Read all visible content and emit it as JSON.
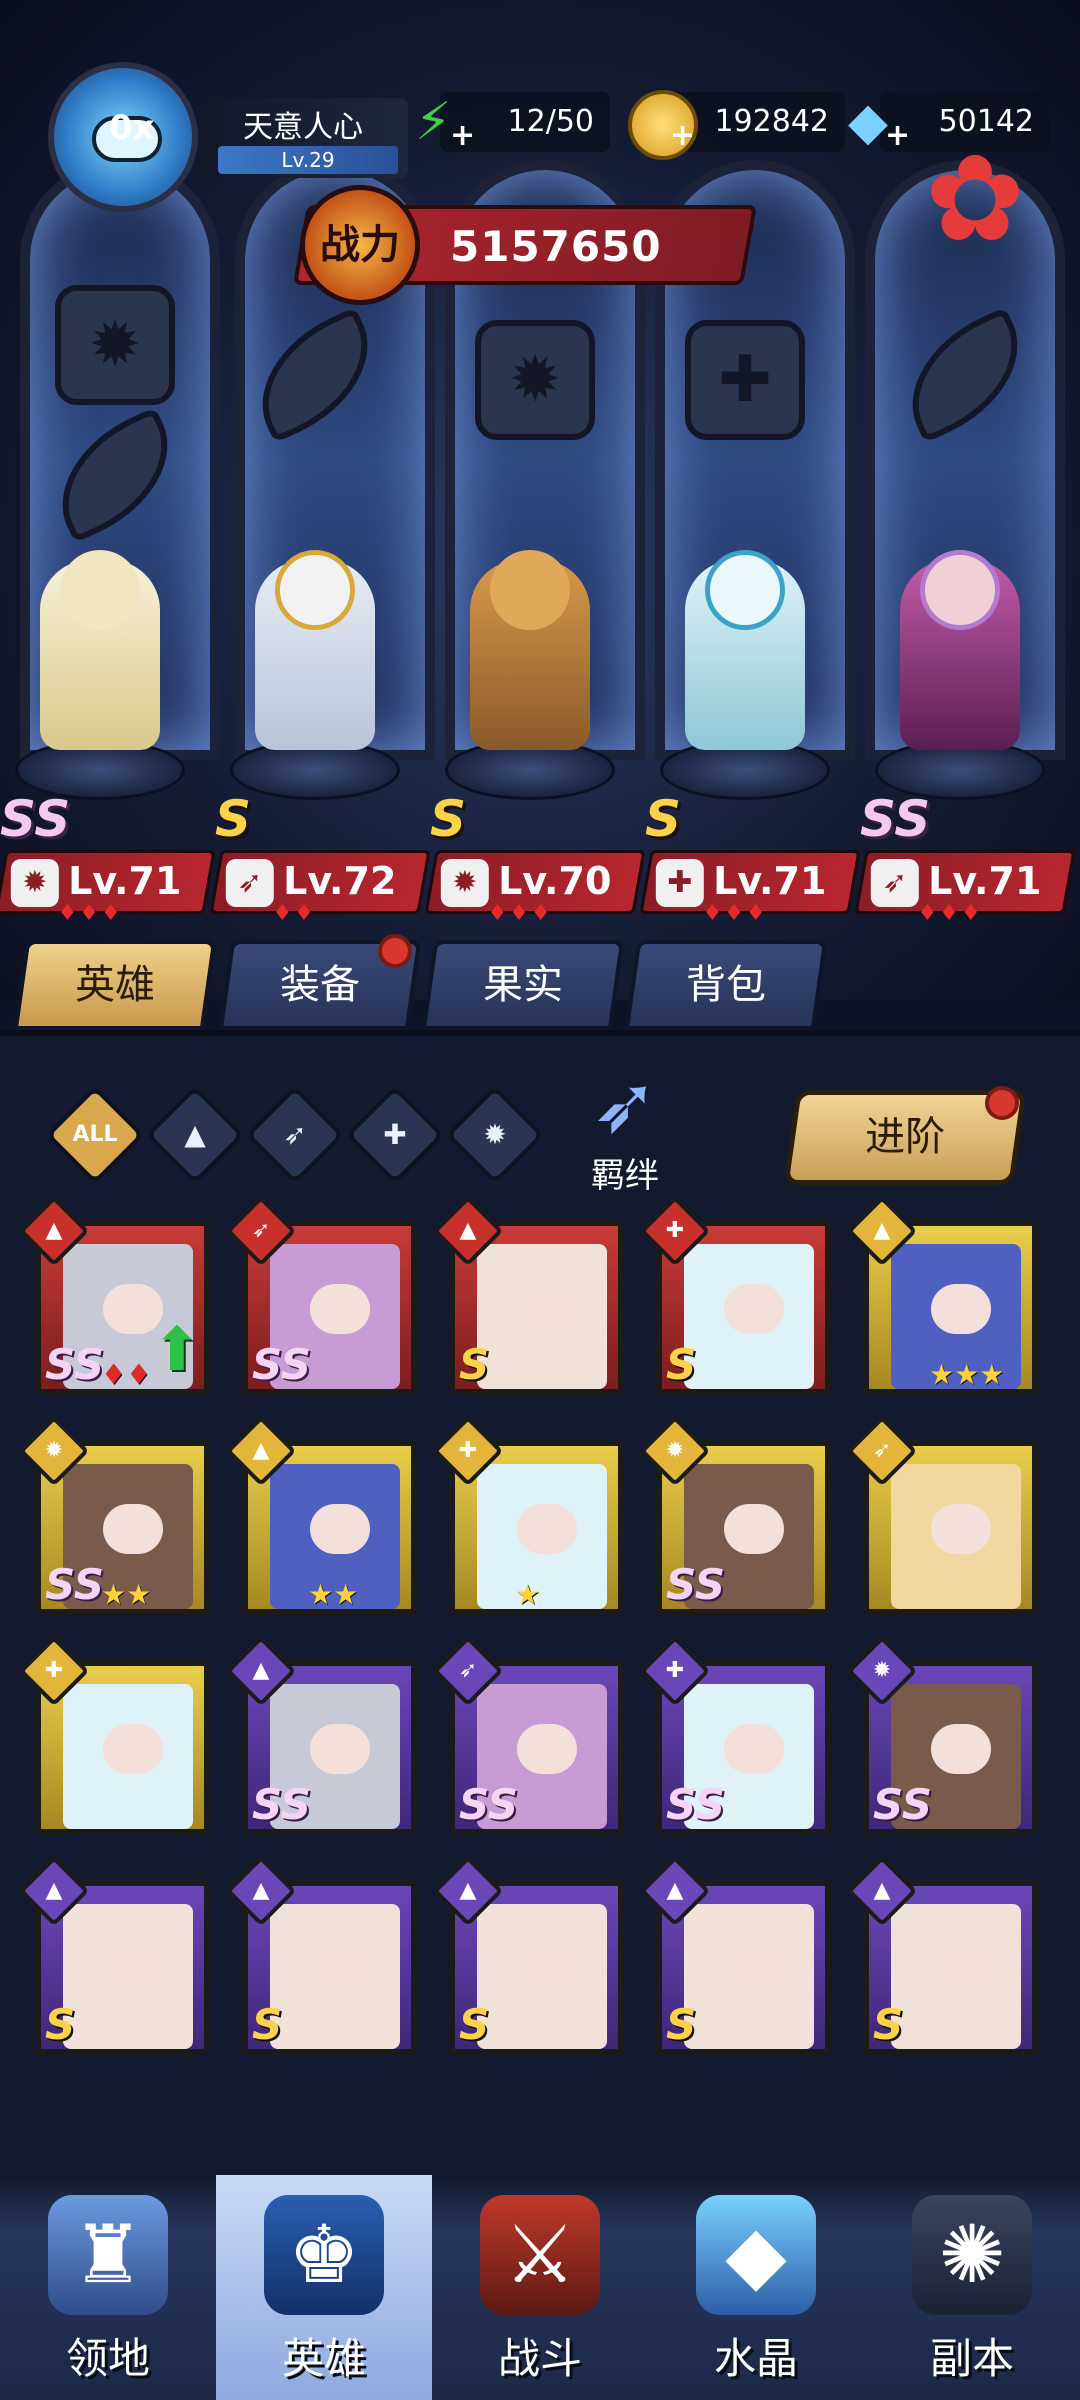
{
  "player": {
    "name": "天意人心",
    "level": "Lv.29",
    "avatar_badge": "0x"
  },
  "resources": {
    "stamina": "12/50",
    "gold": "192842",
    "diamonds": "50142"
  },
  "power": {
    "label": "战力",
    "value": "5157650"
  },
  "lineup": [
    {
      "rank": "SS",
      "level": "Lv.71",
      "class_icon": "beast-icon",
      "stars": "♦♦♦"
    },
    {
      "rank": "S",
      "level": "Lv.72",
      "class_icon": "wing-icon",
      "stars": "♦♦"
    },
    {
      "rank": "S",
      "level": "Lv.70",
      "class_icon": "beast-icon",
      "stars": "♦♦♦"
    },
    {
      "rank": "S",
      "level": "Lv.71",
      "class_icon": "wrench-icon",
      "stars": "♦♦♦"
    },
    {
      "rank": "SS",
      "level": "Lv.71",
      "class_icon": "wing-icon",
      "stars": "♦♦♦"
    }
  ],
  "tabs": [
    {
      "label": "英雄",
      "active": true
    },
    {
      "label": "装备",
      "active": false,
      "dot": true
    },
    {
      "label": "果实",
      "active": false
    },
    {
      "label": "背包",
      "active": false
    }
  ],
  "filters": {
    "all": "ALL",
    "bond": "羁绊",
    "advance": "进阶"
  },
  "grid": [
    {
      "frame": "red",
      "rank": "SS",
      "stars": "♦♦",
      "star_color": "red",
      "arrow": true
    },
    {
      "frame": "red",
      "rank": "SS",
      "stars": "",
      "star_color": ""
    },
    {
      "frame": "red",
      "rank": "S",
      "stars": "",
      "star_color": ""
    },
    {
      "frame": "red",
      "rank": "S",
      "stars": "",
      "star_color": ""
    },
    {
      "frame": "gold",
      "rank": "",
      "stars": "★★★",
      "star_color": "gold"
    },
    {
      "frame": "gold",
      "rank": "SS",
      "stars": "★★",
      "star_color": "gold"
    },
    {
      "frame": "gold",
      "rank": "",
      "stars": "★★",
      "star_color": "gold"
    },
    {
      "frame": "gold",
      "rank": "",
      "stars": "★",
      "star_color": "gold"
    },
    {
      "frame": "gold",
      "rank": "SS",
      "stars": "",
      "star_color": ""
    },
    {
      "frame": "gold",
      "rank": "",
      "stars": "",
      "star_color": ""
    },
    {
      "frame": "gold",
      "rank": "",
      "stars": "",
      "star_color": ""
    },
    {
      "frame": "purple",
      "rank": "SS",
      "stars": "",
      "star_color": ""
    },
    {
      "frame": "purple",
      "rank": "SS",
      "stars": "",
      "star_color": ""
    },
    {
      "frame": "purple",
      "rank": "SS",
      "stars": "",
      "star_color": ""
    },
    {
      "frame": "purple",
      "rank": "SS",
      "stars": "",
      "star_color": ""
    },
    {
      "frame": "purple",
      "rank": "S",
      "stars": "",
      "star_color": ""
    },
    {
      "frame": "purple",
      "rank": "S",
      "stars": "",
      "star_color": ""
    },
    {
      "frame": "purple",
      "rank": "S",
      "stars": "",
      "star_color": ""
    },
    {
      "frame": "purple",
      "rank": "S",
      "stars": "",
      "star_color": ""
    },
    {
      "frame": "purple",
      "rank": "S",
      "stars": "",
      "star_color": ""
    }
  ],
  "bottom_nav": [
    {
      "label": "领地",
      "active": false
    },
    {
      "label": "英雄",
      "active": true
    },
    {
      "label": "战斗",
      "active": false
    },
    {
      "label": "水晶",
      "active": false
    },
    {
      "label": "副本",
      "active": false
    }
  ],
  "colors": {
    "accent_red": "#b8262f",
    "accent_gold": "#c9a059",
    "panel": "#131a2f"
  }
}
